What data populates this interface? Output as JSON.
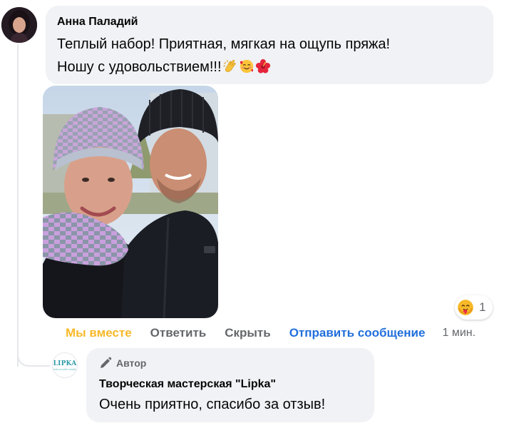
{
  "comment": {
    "author": "Анна Паладий",
    "text_line1": "Теплый набор! Приятная, мягкая на ощупь пряжа!",
    "text_line2": "Ношу с удовольствием!!!",
    "emojis": [
      "clapping-hands-icon",
      "smiling-face-with-hearts-icon",
      "hibiscus-icon"
    ],
    "reaction": {
      "icon": "care-reaction-icon",
      "count": "1"
    },
    "actions": {
      "together": "Мы вместе",
      "reply": "Ответить",
      "hide": "Скрыть",
      "send_message": "Отправить сообщение",
      "time": "1 мин."
    }
  },
  "reply": {
    "badge": "Автор",
    "badge_icon": "pencil-icon",
    "author": "Творческая мастерская \"Lipka\"",
    "text": "Очень приятно, спасибо за отзыв!",
    "logo_text": "LIPKA",
    "logo_subtext": "knit·crochet·studio"
  },
  "colors": {
    "bubble_bg": "#f0f2f5",
    "secondary_text": "#65676b",
    "link_blue": "#216fdb",
    "reaction_yellow": "#f7b928"
  }
}
